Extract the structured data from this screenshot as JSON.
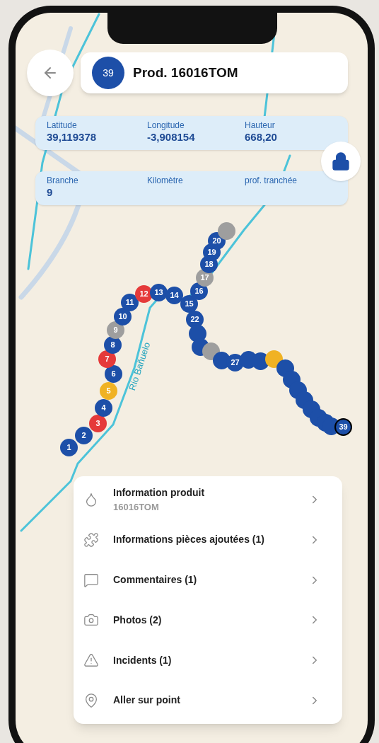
{
  "header": {
    "badge": "39",
    "title": "Prod. 16016TOM"
  },
  "fields": [
    [
      {
        "label": "Latitude",
        "value": "39,119378"
      },
      {
        "label": "Longitude",
        "value": "-3,908154"
      },
      {
        "label": "Hauteur",
        "value": "668,20"
      }
    ],
    [
      {
        "label": "Branche",
        "value": "9"
      },
      {
        "label": "Kilomètre"
      },
      {
        "label": "prof. tranchée"
      }
    ]
  ],
  "map": {
    "river_label": "Rio Bañuelo",
    "markers": [
      {
        "label": "1",
        "color": "#1d4fa8",
        "selected": false
      },
      {
        "label": "2",
        "color": "#1d4fa8",
        "selected": false
      },
      {
        "label": "3",
        "color": "#e53a3a",
        "selected": false
      },
      {
        "label": "4",
        "color": "#1d4fa8",
        "selected": false
      },
      {
        "label": "5",
        "color": "#f0b223",
        "selected": false
      },
      {
        "label": "6",
        "color": "#1d4fa8",
        "selected": false
      },
      {
        "label": "7",
        "color": "#e53a3a",
        "selected": false
      },
      {
        "label": "8",
        "color": "#1d4fa8",
        "selected": false
      },
      {
        "label": "9",
        "color": "#9e9e9e",
        "selected": false
      },
      {
        "label": "10",
        "color": "#1d4fa8",
        "selected": false
      },
      {
        "label": "11",
        "color": "#1d4fa8",
        "selected": false
      },
      {
        "label": "12",
        "color": "#e53a3a",
        "selected": false
      },
      {
        "label": "13",
        "color": "#1d4fa8",
        "selected": false
      },
      {
        "label": "14",
        "color": "#1d4fa8",
        "selected": false
      },
      {
        "label": "15",
        "color": "#1d4fa8",
        "selected": false
      },
      {
        "label": "16",
        "color": "#1d4fa8",
        "selected": false
      },
      {
        "label": "17",
        "color": "#9e9e9e",
        "selected": false
      },
      {
        "label": "18",
        "color": "#1d4fa8",
        "selected": false
      },
      {
        "label": "19",
        "color": "#1d4fa8",
        "selected": false
      },
      {
        "label": "20",
        "color": "#1d4fa8",
        "selected": false
      },
      {
        "color": "#9e9e9e",
        "selected": false
      },
      {
        "label": "22",
        "color": "#1d4fa8",
        "selected": false
      },
      {
        "color": "#1d4fa8",
        "selected": false
      },
      {
        "color": "#1d4fa8",
        "selected": false
      },
      {
        "color": "#9e9e9e",
        "selected": false
      },
      {
        "color": "#1d4fa8",
        "selected": false
      },
      {
        "label": "27",
        "color": "#1d4fa8",
        "selected": false
      },
      {
        "color": "#1d4fa8",
        "selected": false
      },
      {
        "color": "#1d4fa8",
        "selected": false
      },
      {
        "color": "#f0b223",
        "selected": false
      },
      {
        "color": "#1d4fa8",
        "selected": false
      },
      {
        "color": "#1d4fa8",
        "selected": false
      },
      {
        "color": "#1d4fa8",
        "selected": false
      },
      {
        "color": "#1d4fa8",
        "selected": false
      },
      {
        "color": "#1d4fa8",
        "selected": false
      },
      {
        "color": "#1d4fa8",
        "selected": false
      },
      {
        "color": "#1d4fa8",
        "selected": false
      },
      {
        "color": "#1d4fa8",
        "selected": false
      },
      {
        "label": "39",
        "color": "#1d4fa8",
        "selected": true
      }
    ]
  },
  "menu": [
    {
      "kind": "droplet",
      "title": "Information produit",
      "subtitle": "16016TOM"
    },
    {
      "kind": "puzzle",
      "title": "Informations pièces ajoutées (1)"
    },
    {
      "kind": "comment",
      "title": "Commentaires (1)"
    },
    {
      "kind": "camera",
      "title": "Photos (2)"
    },
    {
      "kind": "warning",
      "title": "Incidents (1)"
    },
    {
      "kind": "pin",
      "title": "Aller sur point"
    }
  ]
}
